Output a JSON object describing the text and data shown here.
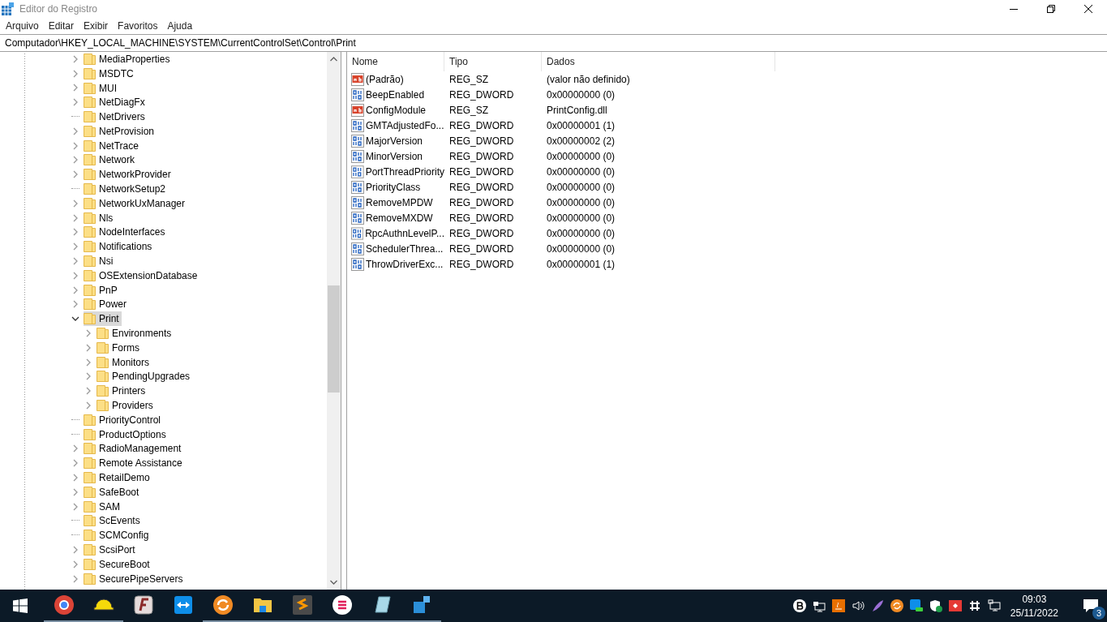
{
  "window": {
    "title": "Editor do Registro"
  },
  "menu": [
    "Arquivo",
    "Editar",
    "Exibir",
    "Favoritos",
    "Ajuda"
  ],
  "address": "Computador\\HKEY_LOCAL_MACHINE\\SYSTEM\\CurrentControlSet\\Control\\Print",
  "tree": [
    {
      "label": "MediaProperties",
      "has_children": true,
      "expanded": false,
      "selected": false
    },
    {
      "label": "MSDTC",
      "has_children": true,
      "expanded": false,
      "selected": false
    },
    {
      "label": "MUI",
      "has_children": true,
      "expanded": false,
      "selected": false
    },
    {
      "label": "NetDiagFx",
      "has_children": true,
      "expanded": false,
      "selected": false
    },
    {
      "label": "NetDrivers",
      "has_children": false,
      "selected": false
    },
    {
      "label": "NetProvision",
      "has_children": true,
      "expanded": false,
      "selected": false
    },
    {
      "label": "NetTrace",
      "has_children": true,
      "expanded": false,
      "selected": false
    },
    {
      "label": "Network",
      "has_children": true,
      "expanded": false,
      "selected": false
    },
    {
      "label": "NetworkProvider",
      "has_children": true,
      "expanded": false,
      "selected": false
    },
    {
      "label": "NetworkSetup2",
      "has_children": false,
      "selected": false
    },
    {
      "label": "NetworkUxManager",
      "has_children": true,
      "expanded": false,
      "selected": false
    },
    {
      "label": "Nls",
      "has_children": true,
      "expanded": false,
      "selected": false
    },
    {
      "label": "NodeInterfaces",
      "has_children": true,
      "expanded": false,
      "selected": false
    },
    {
      "label": "Notifications",
      "has_children": true,
      "expanded": false,
      "selected": false
    },
    {
      "label": "Nsi",
      "has_children": true,
      "expanded": false,
      "selected": false
    },
    {
      "label": "OSExtensionDatabase",
      "has_children": true,
      "expanded": false,
      "selected": false
    },
    {
      "label": "PnP",
      "has_children": true,
      "expanded": false,
      "selected": false
    },
    {
      "label": "Power",
      "has_children": true,
      "expanded": false,
      "selected": false
    },
    {
      "label": "Print",
      "has_children": true,
      "expanded": true,
      "selected": true,
      "children": [
        {
          "label": "Environments",
          "has_children": true,
          "expanded": false,
          "selected": false
        },
        {
          "label": "Forms",
          "has_children": true,
          "expanded": false,
          "selected": false
        },
        {
          "label": "Monitors",
          "has_children": true,
          "expanded": false,
          "selected": false
        },
        {
          "label": "PendingUpgrades",
          "has_children": true,
          "expanded": false,
          "selected": false
        },
        {
          "label": "Printers",
          "has_children": true,
          "expanded": false,
          "selected": false
        },
        {
          "label": "Providers",
          "has_children": true,
          "expanded": false,
          "selected": false
        }
      ]
    },
    {
      "label": "PriorityControl",
      "has_children": false,
      "selected": false
    },
    {
      "label": "ProductOptions",
      "has_children": false,
      "selected": false
    },
    {
      "label": "RadioManagement",
      "has_children": true,
      "expanded": false,
      "selected": false
    },
    {
      "label": "Remote Assistance",
      "has_children": true,
      "expanded": false,
      "selected": false
    },
    {
      "label": "RetailDemo",
      "has_children": true,
      "expanded": false,
      "selected": false
    },
    {
      "label": "SafeBoot",
      "has_children": true,
      "expanded": false,
      "selected": false
    },
    {
      "label": "SAM",
      "has_children": true,
      "expanded": false,
      "selected": false
    },
    {
      "label": "ScEvents",
      "has_children": false,
      "selected": false
    },
    {
      "label": "SCMConfig",
      "has_children": false,
      "selected": false
    },
    {
      "label": "ScsiPort",
      "has_children": true,
      "expanded": false,
      "selected": false
    },
    {
      "label": "SecureBoot",
      "has_children": true,
      "expanded": false,
      "selected": false
    },
    {
      "label": "SecurePipeServers",
      "has_children": true,
      "expanded": false,
      "selected": false
    }
  ],
  "values": {
    "columns": [
      "Nome",
      "Tipo",
      "Dados"
    ],
    "rows": [
      {
        "kind": "string",
        "name": "(Padrão)",
        "type": "REG_SZ",
        "data": "(valor não definido)"
      },
      {
        "kind": "dword",
        "name": "BeepEnabled",
        "type": "REG_DWORD",
        "data": "0x00000000 (0)"
      },
      {
        "kind": "string",
        "name": "ConfigModule",
        "type": "REG_SZ",
        "data": "PrintConfig.dll"
      },
      {
        "kind": "dword",
        "name": "GMTAdjustedFo...",
        "type": "REG_DWORD",
        "data": "0x00000001 (1)"
      },
      {
        "kind": "dword",
        "name": "MajorVersion",
        "type": "REG_DWORD",
        "data": "0x00000002 (2)"
      },
      {
        "kind": "dword",
        "name": "MinorVersion",
        "type": "REG_DWORD",
        "data": "0x00000000 (0)"
      },
      {
        "kind": "dword",
        "name": "PortThreadPriority",
        "type": "REG_DWORD",
        "data": "0x00000000 (0)"
      },
      {
        "kind": "dword",
        "name": "PriorityClass",
        "type": "REG_DWORD",
        "data": "0x00000000 (0)"
      },
      {
        "kind": "dword",
        "name": "RemoveMPDW",
        "type": "REG_DWORD",
        "data": "0x00000000 (0)"
      },
      {
        "kind": "dword",
        "name": "RemoveMXDW",
        "type": "REG_DWORD",
        "data": "0x00000000 (0)"
      },
      {
        "kind": "dword",
        "name": "RpcAuthnLevelP...",
        "type": "REG_DWORD",
        "data": "0x00000000 (0)"
      },
      {
        "kind": "dword",
        "name": "SchedulerThrea...",
        "type": "REG_DWORD",
        "data": "0x00000000 (0)"
      },
      {
        "kind": "dword",
        "name": "ThrowDriverExc...",
        "type": "REG_DWORD",
        "data": "0x00000001 (1)"
      }
    ]
  },
  "taskbar": {
    "apps": [
      {
        "kind": "chrome",
        "running": true
      },
      {
        "kind": "hardhat",
        "running": true
      },
      {
        "kind": "f-app",
        "running": false
      },
      {
        "kind": "remote",
        "running": false
      },
      {
        "kind": "sync",
        "running": true
      },
      {
        "kind": "folder",
        "running": true
      },
      {
        "kind": "editor",
        "running": true
      },
      {
        "kind": "chat",
        "running": true
      },
      {
        "kind": "notepad",
        "running": true
      },
      {
        "kind": "registry",
        "running": true
      }
    ],
    "time": "09:03",
    "date": "25/11/2022",
    "notifications": "3"
  }
}
